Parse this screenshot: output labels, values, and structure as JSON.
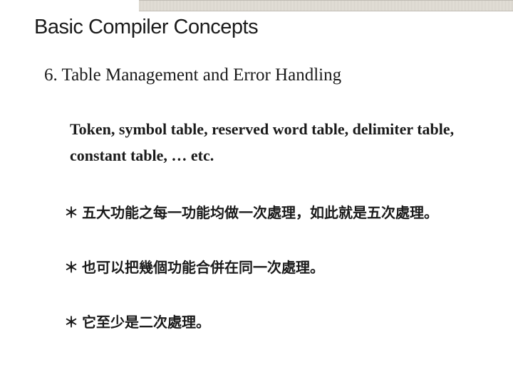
{
  "title": "Basic Compiler Concepts",
  "section": "6. Table Management and Error Handling",
  "body": "Token, symbol table, reserved word table, delimiter table, constant table, … etc.",
  "bullets": [
    "＊ 五大功能之每一功能均做一次處理，如此就是五次處理。",
    "＊ 也可以把幾個功能合併在同一次處理。",
    "＊ 它至少是二次處理。"
  ]
}
